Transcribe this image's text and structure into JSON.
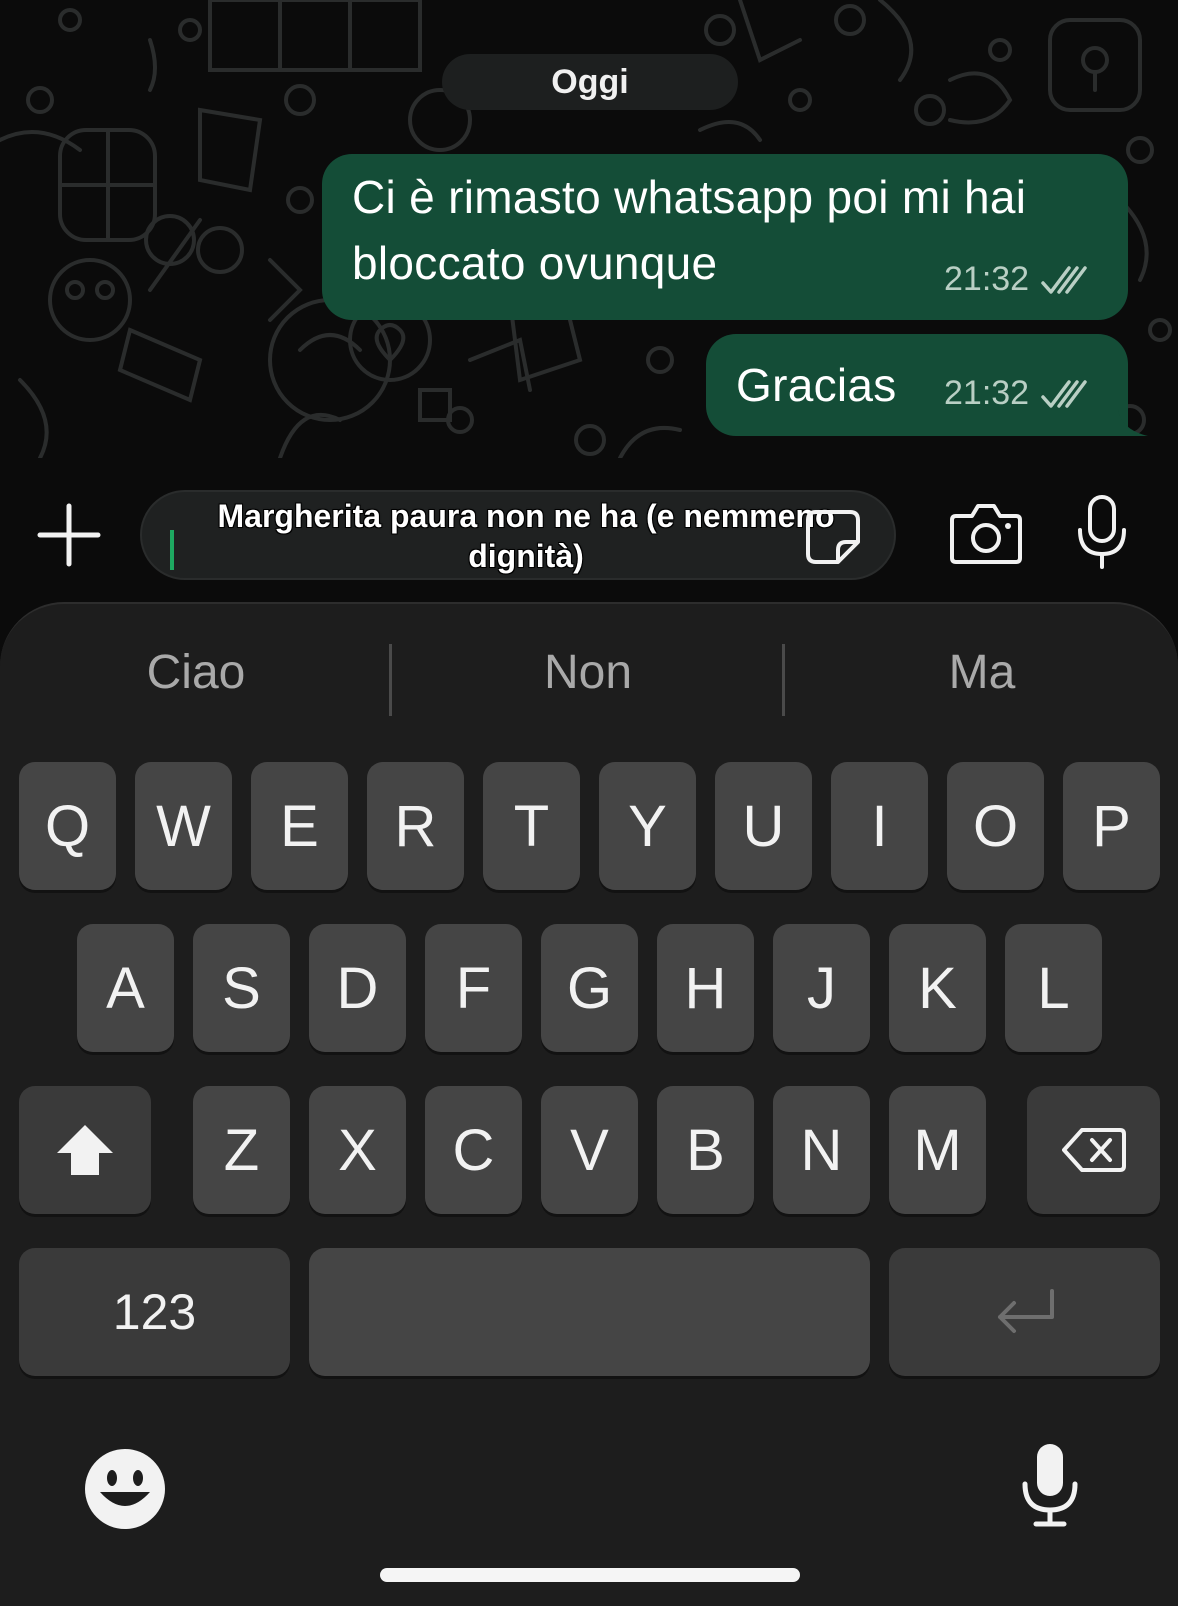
{
  "chat": {
    "date_label": "Oggi",
    "messages": [
      {
        "text_line1": "Ci è rimasto whatsapp poi mi hai",
        "text_line2": "bloccato ovunque",
        "time": "21:32",
        "status_icon": "double-check-icon"
      },
      {
        "text": "Gracias",
        "time": "21:32",
        "status_icon": "double-check-icon"
      }
    ]
  },
  "composer": {
    "typed_text": "Margherita paura non ne ha (e nemmeno dignità)",
    "icons": [
      "plus-icon",
      "sticker-icon",
      "camera-icon",
      "microphone-icon"
    ]
  },
  "keyboard": {
    "suggestions": [
      "Ciao",
      "Non",
      "Ma"
    ],
    "row1": [
      "Q",
      "W",
      "E",
      "R",
      "T",
      "Y",
      "U",
      "I",
      "O",
      "P"
    ],
    "row2": [
      "A",
      "S",
      "D",
      "F",
      "G",
      "H",
      "J",
      "K",
      "L"
    ],
    "row3": [
      "Z",
      "X",
      "C",
      "V",
      "B",
      "N",
      "M"
    ],
    "numbers_key": "123",
    "icons": [
      "shift-icon",
      "backspace-icon",
      "return-icon",
      "emoji-icon",
      "dictation-icon"
    ]
  }
}
